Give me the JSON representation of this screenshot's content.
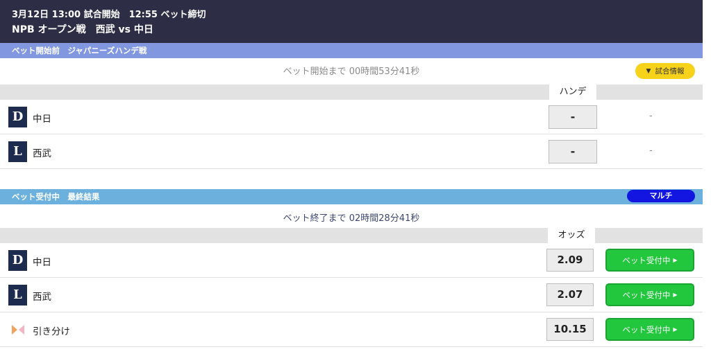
{
  "header": {
    "line1": "3月12日 13:00 試合開始　12:55 ベット締切",
    "line2": "NPB オープン戦　西武 vs 中日"
  },
  "handicap_section": {
    "bar_label": "ベット開始前　ジャパニーズハンデ戦",
    "countdown": "ベット開始まで 00時間53分41秒",
    "info_button": "試合情報",
    "column_header": "ハンデ",
    "rows": [
      {
        "logo": "D",
        "team": "中日",
        "hande": "-",
        "value": "-"
      },
      {
        "logo": "L",
        "team": "西武",
        "hande": "-",
        "value": "-"
      }
    ]
  },
  "final_section": {
    "bar_label": "ベット受付中　最終結果",
    "badge": "マルチ",
    "countdown": "ベット終了まで 02時間28分41秒",
    "column_header": "オッズ",
    "rows": [
      {
        "logo": "D",
        "team": "中日",
        "odds": "2.09",
        "button": "ベット受付中"
      },
      {
        "logo": "L",
        "team": "西武",
        "odds": "2.07",
        "button": "ベット受付中"
      },
      {
        "logo": "",
        "team": "引き分け",
        "odds": "10.15",
        "button": "ベット受付中",
        "icon": "draw-icon"
      }
    ]
  },
  "colors": {
    "header_bg": "#2d2e45",
    "bar1_bg": "#8197e0",
    "bar2_bg": "#6cb0de",
    "bet_button": "#22c73d",
    "info_button": "#f7d21a",
    "multi_badge": "#1216e0"
  }
}
